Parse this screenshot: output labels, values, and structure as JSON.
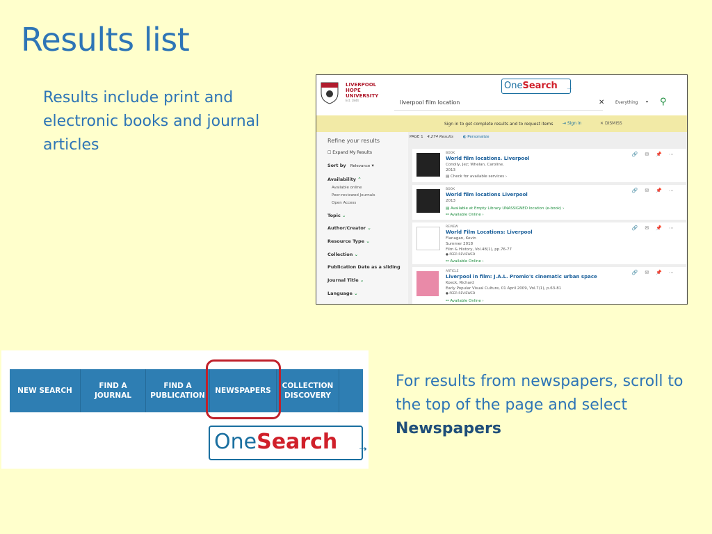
{
  "slide": {
    "title": "Results list",
    "intro": "Results include print and electronic books and journal articles",
    "outro_prefix": "For results from newspapers, scroll to the top of the page and select ",
    "outro_bold": "Newspapers"
  },
  "screenshot1": {
    "university": [
      "LIVERPOOL",
      "HOPE",
      "UNIVERSITY"
    ],
    "university_est": "Est. 1844",
    "logo": {
      "one": "One",
      "search": "Search"
    },
    "search": {
      "query": "liverpool film location",
      "scope": "Everything"
    },
    "signin_bar": {
      "message": "Sign in to get complete results and to request items",
      "signin": "Sign in",
      "dismiss": "DISMISS"
    },
    "sidebar": {
      "refine": "Refine your results",
      "expand": "Expand My Results",
      "sort_by": "Sort by",
      "sort_value": "Relevance",
      "availability": "Availability",
      "availability_items": [
        "Available online",
        "Peer-reviewed Journals",
        "Open Access"
      ],
      "facets": [
        "Topic",
        "Author/Creator",
        "Resource Type",
        "Collection",
        "Publication Date as a sliding",
        "Journal Title",
        "Language"
      ]
    },
    "page_info": {
      "page": "PAGE 1",
      "count": "4,274 Results",
      "personalize": "Personalize"
    },
    "results": [
      {
        "type": "BOOK",
        "title": "World film locations. Liverpool",
        "lines": [
          "Conolly, Jez; Whelan, Caroline.",
          "2013"
        ],
        "avail": "Check for available services"
      },
      {
        "type": "BOOK",
        "title": "World film locations Liverpool",
        "lines": [
          "2013"
        ],
        "avail": "Available at Empty Library  UNASSIGNED location (e-book)",
        "avail2": "Available Online"
      },
      {
        "type": "REVIEW",
        "title": "World Film Locations: Liverpool",
        "lines": [
          "Flanagan, Kevin",
          "Summer 2018",
          "Film & History, Vol.48(1), pp.76-77"
        ],
        "peer": "PEER REVIEWED",
        "avail": "Available Online"
      },
      {
        "type": "ARTICLE",
        "title": "Liverpool in film: J.A.L. Promio's cinematic urban space",
        "lines": [
          "Koeck, Richard",
          "Early Popular Visual Culture, 01 April 2009, Vol.7(1), p.63-81"
        ],
        "peer": "PEER REVIEWED",
        "avail": "Available Online"
      }
    ]
  },
  "screenshot2": {
    "nav": [
      "NEW SEARCH",
      "FIND A JOURNAL",
      "FIND A PUBLICATION",
      "NEWSPAPERS",
      "COLLECTION DISCOVERY"
    ],
    "logo": {
      "one": "One",
      "search": "Search"
    }
  },
  "colors": {
    "background": "#ffffcc",
    "title": "#2e75b6",
    "nav": "#2e7eb3",
    "highlight": "#c0202a"
  }
}
